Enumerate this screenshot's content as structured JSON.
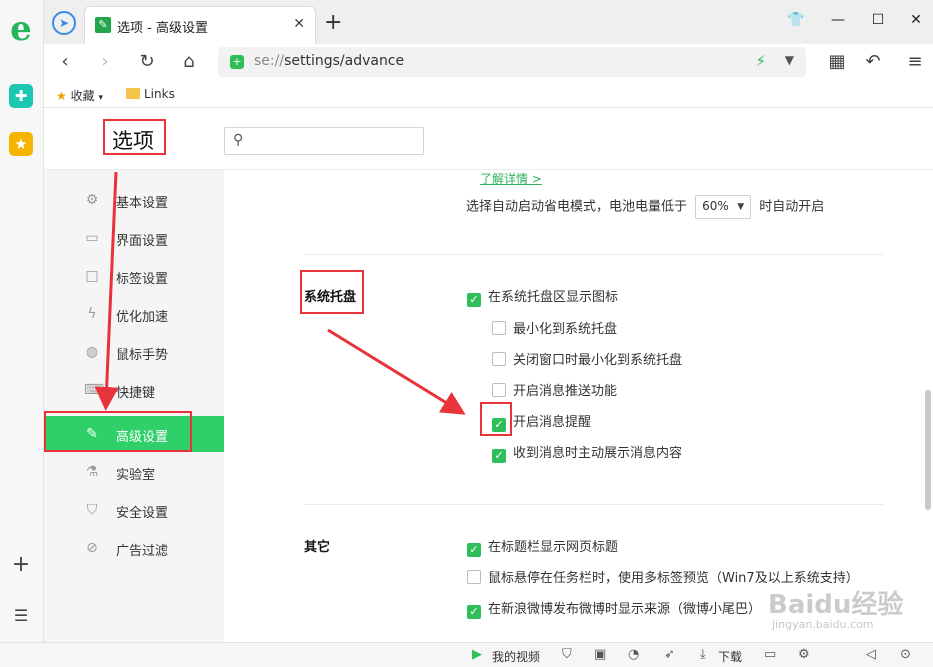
{
  "browser": {
    "tab_title": "选项 - 高级设置",
    "address_prefix": "se://",
    "address_path": "settings/advance",
    "bookmarks": [
      {
        "label": "收藏",
        "icon": "star-icon"
      },
      {
        "label": "Links",
        "icon": "folder-icon"
      }
    ]
  },
  "page": {
    "title": "选项",
    "search_placeholder": ""
  },
  "sidebar": {
    "items": [
      {
        "label": "基本设置",
        "icon": "gear-icon",
        "active": false
      },
      {
        "label": "界面设置",
        "icon": "window-icon",
        "active": false
      },
      {
        "label": "标签设置",
        "icon": "tab-icon",
        "active": false
      },
      {
        "label": "优化加速",
        "icon": "lightning-icon",
        "active": false
      },
      {
        "label": "鼠标手势",
        "icon": "mouse-icon",
        "active": false
      },
      {
        "label": "快捷键",
        "icon": "keyboard-icon",
        "active": false
      },
      {
        "label": "高级设置",
        "icon": "wrench-icon",
        "active": true
      },
      {
        "label": "实验室",
        "icon": "flask-icon",
        "active": false
      },
      {
        "label": "安全设置",
        "icon": "shield-icon",
        "active": false
      },
      {
        "label": "广告过滤",
        "icon": "block-icon",
        "active": false
      }
    ]
  },
  "content": {
    "learn_more": "了解详情 >",
    "battery_prefix": "选择自动启动省电模式，电池电量低于",
    "battery_value": "60%",
    "battery_suffix": "时自动开启",
    "tray": {
      "title": "系统托盘",
      "options": [
        {
          "label": "在系统托盘区显示图标",
          "checked": true
        },
        {
          "label": "最小化到系统托盘",
          "checked": false
        },
        {
          "label": "关闭窗口时最小化到系统托盘",
          "checked": false
        },
        {
          "label": "开启消息推送功能",
          "checked": false
        },
        {
          "label": "开启消息提醒",
          "checked": true
        },
        {
          "label": "收到消息时主动展示消息内容",
          "checked": true
        }
      ]
    },
    "other": {
      "title": "其它",
      "options": [
        {
          "label": "在标题栏显示网页标题",
          "checked": true
        },
        {
          "label": "鼠标悬停在任务栏时，使用多标签预览（Win7及以上系统支持）",
          "checked": false
        },
        {
          "label": "在新浪微博发布微博时显示来源（微博小尾巴）",
          "checked": true
        }
      ]
    }
  },
  "statusbar": {
    "video": "我的视频",
    "download": "下载"
  },
  "watermark": {
    "text": "Baidu经验",
    "sub": "jingyan.baidu.com"
  },
  "colors": {
    "accent": "#2fcf69",
    "annotation": "#e8333b"
  }
}
